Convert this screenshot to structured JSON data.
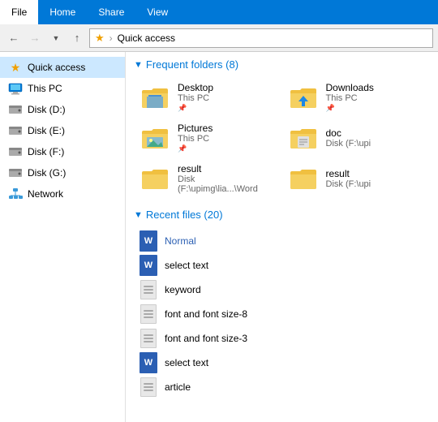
{
  "ribbon": {
    "tabs": [
      {
        "id": "file",
        "label": "File",
        "active": true
      },
      {
        "id": "home",
        "label": "Home",
        "active": false
      },
      {
        "id": "share",
        "label": "Share",
        "active": false
      },
      {
        "id": "view",
        "label": "View",
        "active": false
      }
    ]
  },
  "addressBar": {
    "back_tooltip": "Back",
    "forward_tooltip": "Forward",
    "up_tooltip": "Up",
    "path": "Quick access"
  },
  "sidebar": {
    "items": [
      {
        "id": "quick-access",
        "label": "Quick access",
        "icon": "star",
        "active": true
      },
      {
        "id": "this-pc",
        "label": "This PC",
        "icon": "pc",
        "active": false
      },
      {
        "id": "disk-d",
        "label": "Disk (D:)",
        "icon": "disk",
        "active": false
      },
      {
        "id": "disk-e",
        "label": "Disk (E:)",
        "icon": "disk",
        "active": false
      },
      {
        "id": "disk-f",
        "label": "Disk (F:)",
        "icon": "disk",
        "active": false
      },
      {
        "id": "disk-g",
        "label": "Disk (G:)",
        "icon": "disk",
        "active": false
      },
      {
        "id": "network",
        "label": "Network",
        "icon": "network",
        "active": false
      }
    ]
  },
  "frequent": {
    "header": "Frequent folders",
    "count": 8,
    "folders": [
      {
        "name": "Desktop",
        "sub": "This PC",
        "pinned": true,
        "type": "plain"
      },
      {
        "name": "Downloads",
        "sub": "This PC",
        "pinned": true,
        "type": "download"
      },
      {
        "name": "Pictures",
        "sub": "This PC",
        "pinned": true,
        "type": "pictures"
      },
      {
        "name": "doc",
        "sub": "Disk (F:\\upi",
        "pinned": false,
        "type": "doc"
      },
      {
        "name": "result",
        "sub": "Disk (F:\\upimg\\lia...\\Word",
        "pinned": false,
        "type": "plain"
      },
      {
        "name": "result",
        "sub": "Disk (F:\\upi",
        "pinned": false,
        "type": "plain"
      }
    ]
  },
  "recent": {
    "header": "Recent files",
    "count": 20,
    "files": [
      {
        "name": "Normal",
        "type": "word-blue"
      },
      {
        "name": "select text",
        "type": "word"
      },
      {
        "name": "keyword",
        "type": "doc"
      },
      {
        "name": "font and font size-8",
        "type": "doc"
      },
      {
        "name": "font and font size-3",
        "type": "doc"
      },
      {
        "name": "select text",
        "type": "word"
      },
      {
        "name": "article",
        "type": "doc"
      }
    ]
  }
}
